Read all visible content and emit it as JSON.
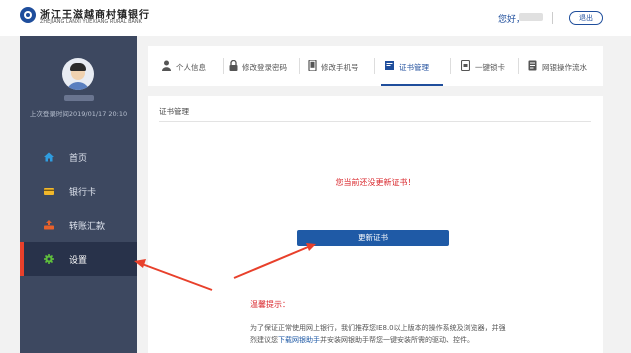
{
  "header": {
    "bank_name": "浙江王滋越商村镇银行",
    "bank_en": "ZHEJIANG LANXI YUEXIANG RURAL BANK",
    "greeting": "您好，",
    "logout": "退出"
  },
  "sidebar": {
    "last_login": "上次登录时间2019/01/17 20:10",
    "items": [
      {
        "label": "首页",
        "icon": "home-icon"
      },
      {
        "label": "银行卡",
        "icon": "card-icon"
      },
      {
        "label": "转账汇款",
        "icon": "transfer-icon"
      },
      {
        "label": "设置",
        "icon": "gear-icon",
        "active": true
      }
    ]
  },
  "tabs": [
    {
      "label": "个人信息",
      "icon": "person-icon"
    },
    {
      "label": "修改登录密码",
      "icon": "lock-icon"
    },
    {
      "label": "修改手机号",
      "icon": "phone-icon"
    },
    {
      "label": "证书管理",
      "icon": "certificate-icon",
      "active": true
    },
    {
      "label": "一键锁卡",
      "icon": "lock-card-icon"
    },
    {
      "label": "网银操作流水",
      "icon": "document-icon"
    }
  ],
  "main": {
    "section_title": "证书管理",
    "notice": "您当前还没更新证书！",
    "update_button": "更新证书",
    "tips_title": "温馨提示：",
    "tips_text_1": "为了保证正常使用网上银行，我们推荐您IE8.0以上版本的操作系统及浏览器，并强烈建议您",
    "tips_link": "下载网银助手",
    "tips_text_2": "并安装网银助手帮您一键安装所需的驱动、控件。"
  },
  "colors": {
    "sidebar": "#3d4860",
    "primary": "#1f4e9c",
    "alert": "#d9262b",
    "annotation_arrow": "#e8402b"
  }
}
